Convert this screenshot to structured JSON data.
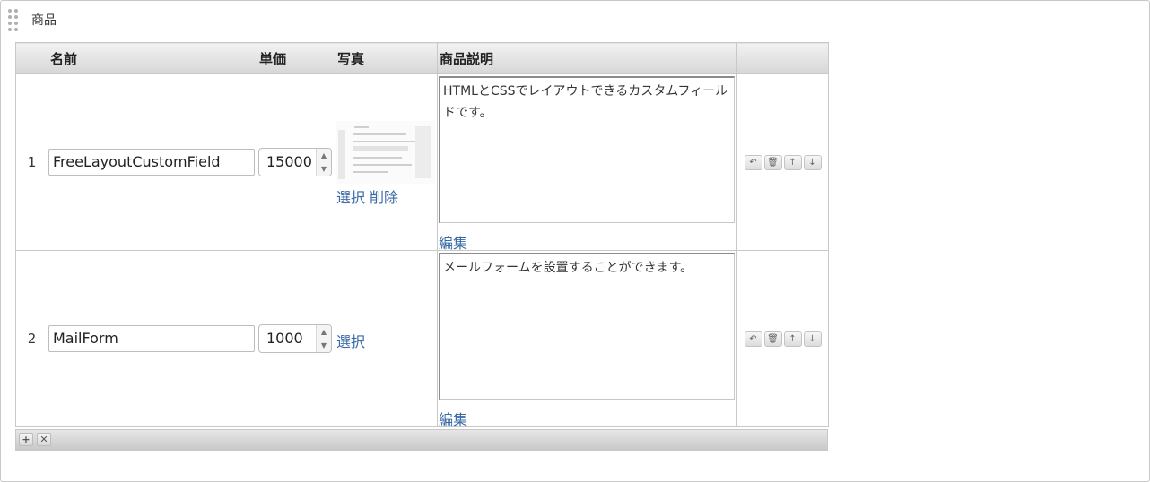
{
  "panel": {
    "title": "商品"
  },
  "table": {
    "headers": [
      "",
      "名前",
      "単価",
      "写真",
      "商品説明",
      ""
    ],
    "rows": [
      {
        "num": "1",
        "name": "FreeLayoutCustomField",
        "price": "15000",
        "photo_links": [
          "選択",
          "削除"
        ],
        "description": "HTMLとCSSでレイアウトできるカスタムフィールドです。",
        "edit_label": "編集"
      },
      {
        "num": "2",
        "name": "MailForm",
        "price": "1000",
        "photo_links": [
          "選択"
        ],
        "description": "メールフォームを設置することができます。",
        "edit_label": "編集"
      }
    ]
  },
  "row_action_icons": [
    "undo-icon",
    "trash-icon",
    "arrow-up-icon",
    "arrow-down-icon"
  ],
  "footer_icons": [
    "plus-icon",
    "close-icon"
  ],
  "colors": {
    "link": "#3a6aa6",
    "border": "#c8c8c8",
    "header_top": "#f2f2f2",
    "header_bottom": "#d6d6d6"
  }
}
